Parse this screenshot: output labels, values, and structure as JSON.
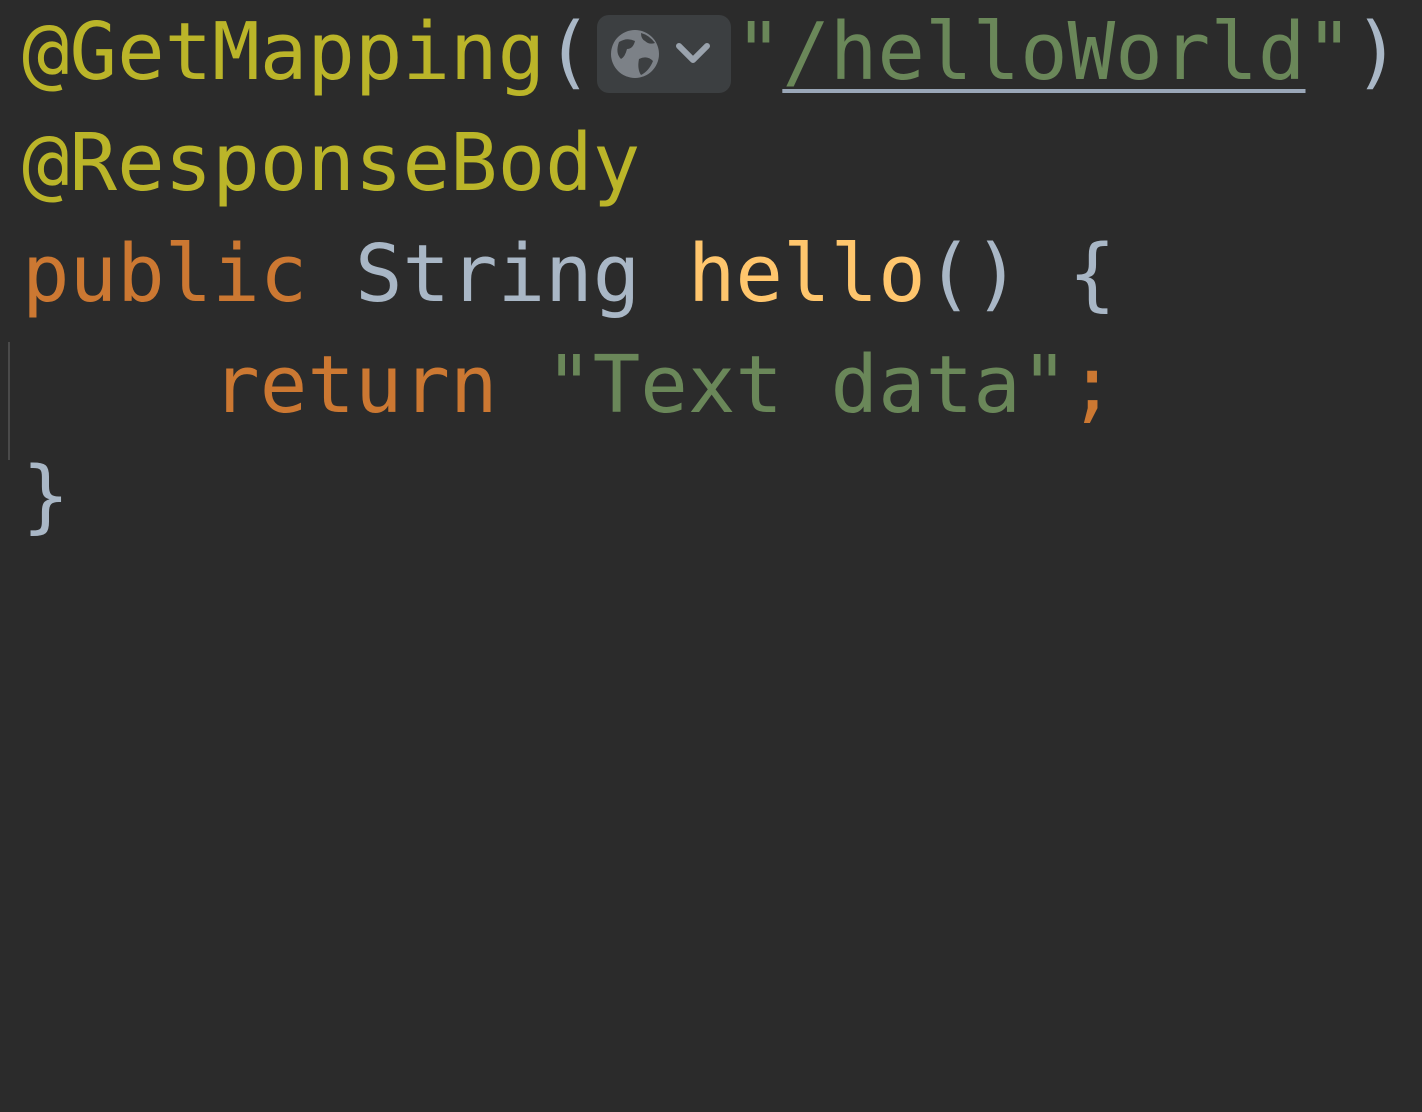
{
  "editor": {
    "language": "java",
    "lines": {
      "line1": {
        "annotation": "@GetMapping",
        "open_paren": "(",
        "quote_open": "\"",
        "url": "/helloWorld",
        "quote_close": "\"",
        "close_paren": ")"
      },
      "line2": {
        "annotation": "@ResponseBody"
      },
      "line3": {
        "keyword": "public",
        "type": "String",
        "method": "hello",
        "params": "()",
        "brace": "{"
      },
      "line4": {
        "keyword": "return",
        "string": "\"Text data\"",
        "semicolon": ";"
      },
      "line5": {
        "brace": "}"
      }
    },
    "inlay_hint": {
      "icon": "globe-icon",
      "chevron": "chevron-down-icon"
    },
    "colors": {
      "background": "#2b2b2b",
      "annotation": "#bbb529",
      "string": "#6a8759",
      "keyword": "#cc7832",
      "method": "#ffc66d",
      "default_text": "#a9b7c6"
    }
  }
}
